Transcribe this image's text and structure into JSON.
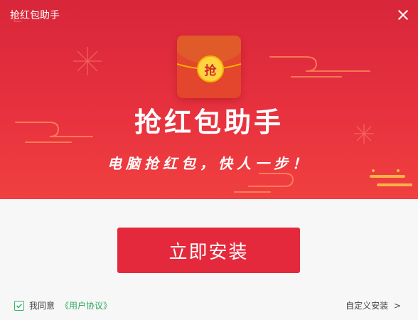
{
  "window": {
    "title": "抢红包助手",
    "close_icon": "close-icon"
  },
  "banner": {
    "envelope_char": "抢",
    "app_name": "抢红包助手",
    "slogan": "电脑抢红包，快人一步！",
    "colors": {
      "background": "#e2303e",
      "envelope": "#e3452d",
      "seal": "#ffd33f",
      "decor": "#ff7a52"
    }
  },
  "actions": {
    "install_label": "立即安装",
    "install_color": "#e5293c"
  },
  "footer": {
    "agree_checked": true,
    "agree_label": "我同意",
    "agreement_link": "《用户协议》",
    "custom_install_label": "自定义安装",
    "custom_install_arrow": ">"
  }
}
